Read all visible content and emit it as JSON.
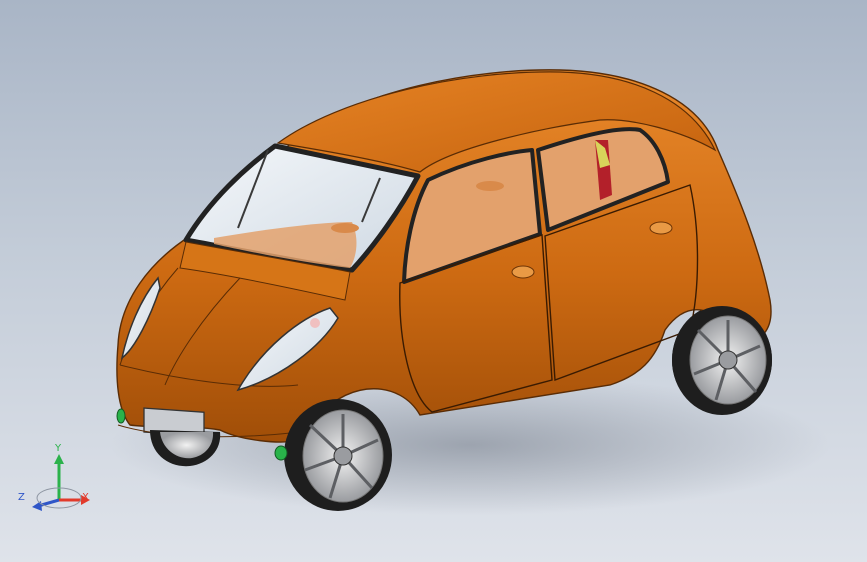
{
  "viewport": {
    "background_top": "#a9b5c6",
    "background_bottom": "#dfe3ea"
  },
  "model": {
    "body_color": "#cd6a12",
    "glass_color": "#dde6ee",
    "interior_color": "#e3a16c",
    "tire_color": "#1e1e1e",
    "rim_color": "#c9cacd",
    "indicator_color": "#29b34a"
  },
  "triad": {
    "x_label": "X",
    "y_label": "Y",
    "z_label": "Z",
    "x_color": "#e23a2b",
    "y_color": "#2bb24b",
    "z_color": "#2f56c8"
  }
}
